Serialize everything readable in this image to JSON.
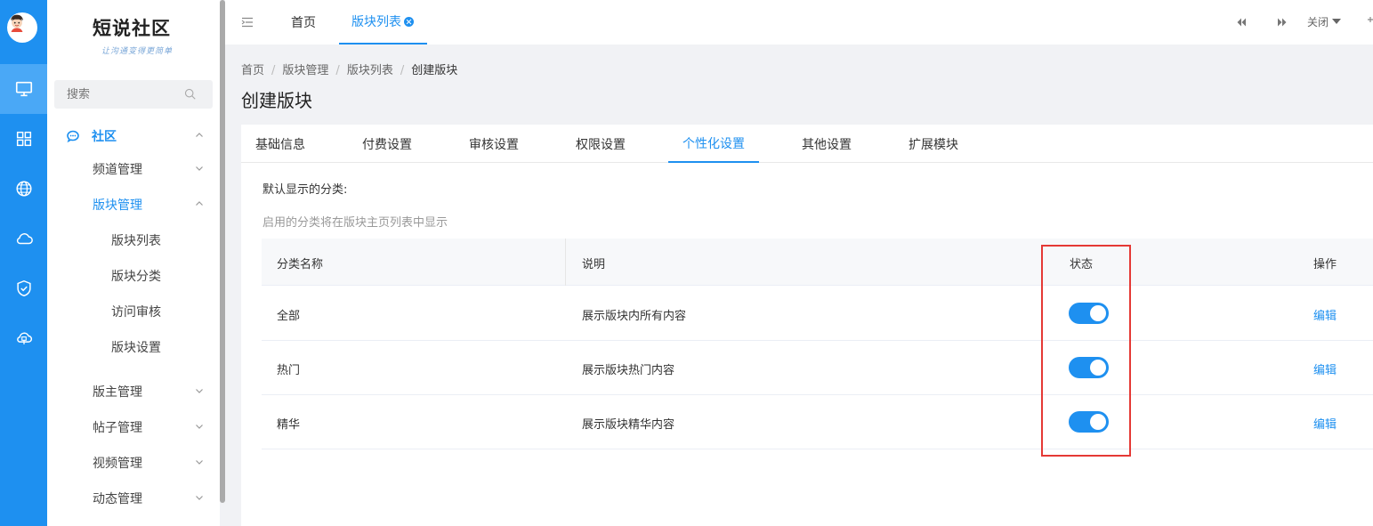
{
  "rail": {
    "items": [
      "monitor-icon",
      "grid-icon",
      "globe-icon",
      "cloud-icon",
      "shield-check-icon",
      "cloud-network-icon"
    ],
    "active_index": 0
  },
  "brand": {
    "title": "短说社区",
    "slogan": "让沟通变得更简单"
  },
  "sidebar": {
    "search_placeholder": "搜索",
    "group_label": "社区",
    "items": [
      {
        "label": "频道管理",
        "level": "sub",
        "expanded": false
      },
      {
        "label": "版块管理",
        "level": "sub",
        "expanded": true,
        "active": true
      },
      {
        "label": "版块列表",
        "level": "leaf"
      },
      {
        "label": "版块分类",
        "level": "leaf"
      },
      {
        "label": "访问审核",
        "level": "leaf"
      },
      {
        "label": "版块设置",
        "level": "leaf"
      },
      {
        "label": "版主管理",
        "level": "sub",
        "expanded": false
      },
      {
        "label": "帖子管理",
        "level": "sub",
        "expanded": false
      },
      {
        "label": "视频管理",
        "level": "sub",
        "expanded": false
      },
      {
        "label": "动态管理",
        "level": "sub",
        "expanded": false
      }
    ]
  },
  "topbar": {
    "tabs": [
      {
        "label": "首页",
        "active": false
      },
      {
        "label": "版块列表",
        "active": true
      }
    ],
    "close_label": "关闭"
  },
  "breadcrumb": [
    "首页",
    "版块管理",
    "版块列表",
    "创建版块"
  ],
  "page_title": "创建版块",
  "form_tabs": [
    "基础信息",
    "付费设置",
    "审核设置",
    "权限设置",
    "个性化设置",
    "其他设置",
    "扩展模块"
  ],
  "active_form_tab": 4,
  "section": {
    "label": "默认显示的分类:",
    "hint": "启用的分类将在版块主页列表中显示"
  },
  "table": {
    "headers": [
      "分类名称",
      "说明",
      "状态",
      "操作"
    ],
    "rows": [
      {
        "name": "全部",
        "desc": "展示版块内所有内容",
        "enabled": true,
        "action": "编辑"
      },
      {
        "name": "热门",
        "desc": "展示版块热门内容",
        "enabled": true,
        "action": "编辑"
      },
      {
        "name": "精华",
        "desc": "展示版块精华内容",
        "enabled": true,
        "action": "编辑"
      }
    ]
  },
  "colors": {
    "accent": "#1e90f0",
    "rail_bg": "#1e90f0",
    "highlight_box": "#e53935"
  }
}
